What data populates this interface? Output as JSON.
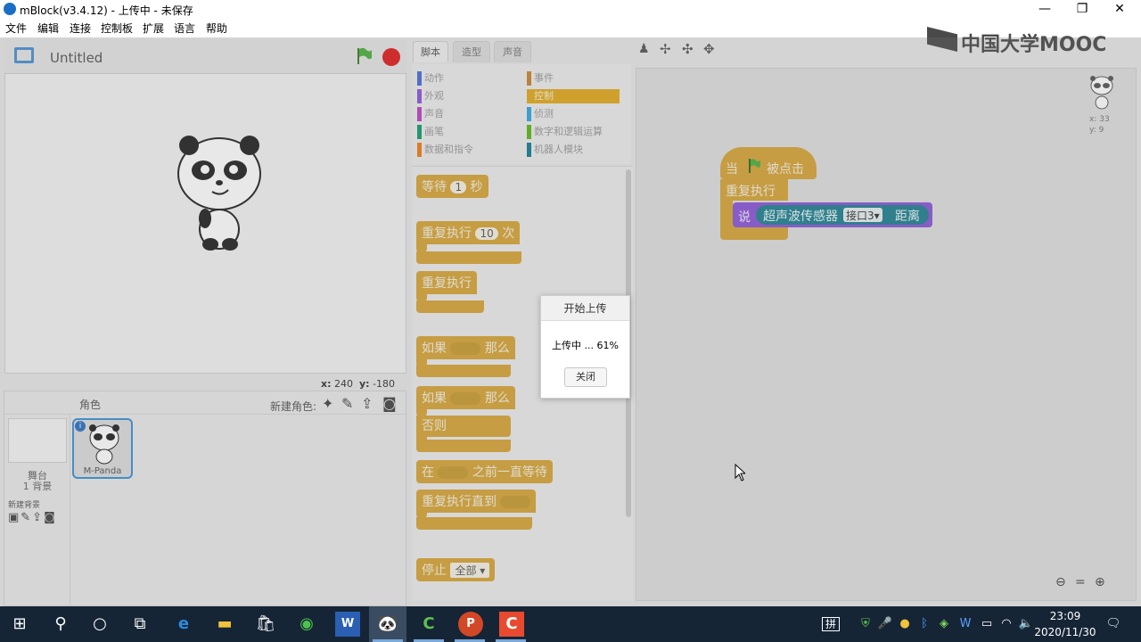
{
  "window": {
    "title": "mBlock(v3.4.12) - 上传中 - 未保存",
    "minimize": "—",
    "restore": "❐",
    "close": "✕"
  },
  "menu": [
    "文件",
    "编辑",
    "连接",
    "控制板",
    "扩展",
    "语言",
    "帮助"
  ],
  "watermark": "中国大学MOOC",
  "stage": {
    "project_name": "Untitled",
    "x_label": "x:",
    "x_value": "240",
    "y_label": "y:",
    "y_value": "-180"
  },
  "sprites": {
    "title": "角色",
    "new_sprite_label": "新建角色:",
    "stage_label": "舞台",
    "backdrop_count": "1 背景",
    "new_backdrop_label": "新建背景",
    "sprite_name": "M-Panda"
  },
  "tabs": [
    "脚本",
    "造型",
    "声音"
  ],
  "categories": [
    {
      "label": "动作",
      "color": "#4a6cd4"
    },
    {
      "label": "事件",
      "color": "#c88330"
    },
    {
      "label": "外观",
      "color": "#8a55d7"
    },
    {
      "label": "控制",
      "color": "#e1a91a"
    },
    {
      "label": "声音",
      "color": "#bb42c3"
    },
    {
      "label": "侦测",
      "color": "#2ca5e2"
    },
    {
      "label": "画笔",
      "color": "#0e9a6c"
    },
    {
      "label": "数字和逻辑运算",
      "color": "#5cb712"
    },
    {
      "label": "数据和指令",
      "color": "#ee7d16"
    },
    {
      "label": "机器人模块",
      "color": "#0f7d8f"
    }
  ],
  "palette": {
    "wait": "等待",
    "wait_val": "1",
    "wait_unit": "秒",
    "repeat": "重复执行",
    "repeat_val": "10",
    "repeat_unit": "次",
    "forever": "重复执行",
    "if": "如果",
    "then": "那么",
    "if2": "如果",
    "then2": "那么",
    "else": "否则",
    "wait_until_a": "在",
    "wait_until_b": "之前一直等待",
    "repeat_until": "重复执行直到",
    "stop": "停止",
    "stop_val": "全部"
  },
  "script": {
    "when": "当",
    "clicked": "被点击",
    "forever": "重复执行",
    "say": "说",
    "sensor": "超声波传感器",
    "port": "接口3",
    "distance": "距离"
  },
  "sprite_info": {
    "x": "x: 33",
    "y": "y: 9"
  },
  "dialog": {
    "title": "开始上传",
    "message": "上传中 ... 61%",
    "close": "关闭"
  },
  "taskbar": {
    "time": "23:09",
    "date": "2020/11/30",
    "ime": "拼",
    "word_label": "W",
    "ppt_label": "P"
  }
}
